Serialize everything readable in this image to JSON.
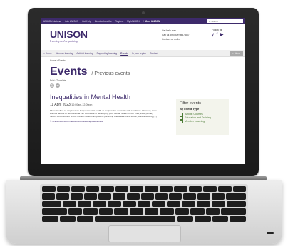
{
  "site": {
    "topbar": {
      "links": [
        "UNISON National",
        "Join UNISON",
        "Get Help",
        "Member benefits",
        "Regions",
        "My UNISON"
      ],
      "more": "+ More UNISON",
      "search_placeholder": "Q Search"
    },
    "logo": {
      "main": "UNISON",
      "sub": "learning and organising"
    },
    "contact": {
      "help": "Get help now",
      "call": "Call us on 0800 0857 857",
      "online": "Contact us online"
    },
    "follow": {
      "label": "Follow us",
      "icons": "y f ▶"
    },
    "nav": {
      "items": [
        "⌂ Home",
        "Member learning",
        "Activist learning",
        "Supporting learning",
        "Events",
        "In your region",
        "Contact"
      ],
      "active_index": 4,
      "menu": "≡ Menu"
    },
    "breadcrumb": "Home  >  Events",
    "page": {
      "title": "Events",
      "subtitle": "/  Previous events",
      "print": "Print / Translate"
    },
    "event": {
      "title": "Inequalities in Mental Health",
      "date": "11 April 2023",
      "time": "10:00am-12:00pm",
      "description": "There is often no single cause for poor mental health or diagnosable mental health conditions. However, there are risk factors or our lives that can contribute to developing poor mental health. In our lives, three primary factors which impact on our mental health from positive parenting and a safe place to live, to experiencing [...]",
      "tags": "activist education   interests   workplace representatives"
    },
    "filter": {
      "title": "Filter events",
      "subtitle": "By Event Type",
      "options": [
        "Activist Courses",
        "Education and Training",
        "Member Learning"
      ]
    }
  }
}
